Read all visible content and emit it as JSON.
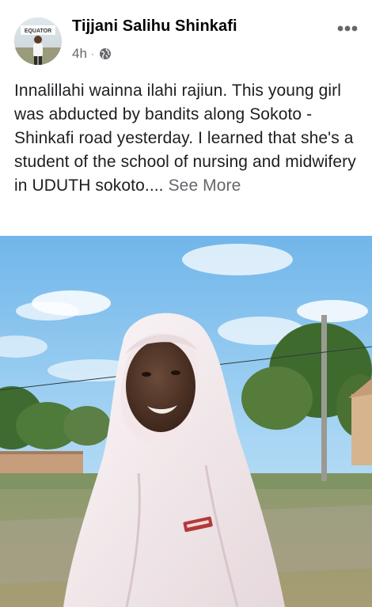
{
  "post": {
    "author_name": "Tijjani Salihu Shinkafi",
    "timestamp": "4h",
    "separator": "·",
    "privacy_icon": "globe-icon",
    "more_icon": "more-options-icon",
    "text_body": "Innalillahi wainna ilahi rajiun. This young girl was abducted by bandits along Sokoto - Shinkafi road yesterday. I learned that she's a student of the school of nursing and midwifery in UDUTH sokoto.",
    "text_ellipsis": "...",
    "see_more_label": "See More",
    "avatar_caption": "EQUATOR"
  },
  "colors": {
    "text_primary": "#050505",
    "text_secondary": "#65676b",
    "sky": "#8ec7f0",
    "hijab": "#f7eef0"
  }
}
